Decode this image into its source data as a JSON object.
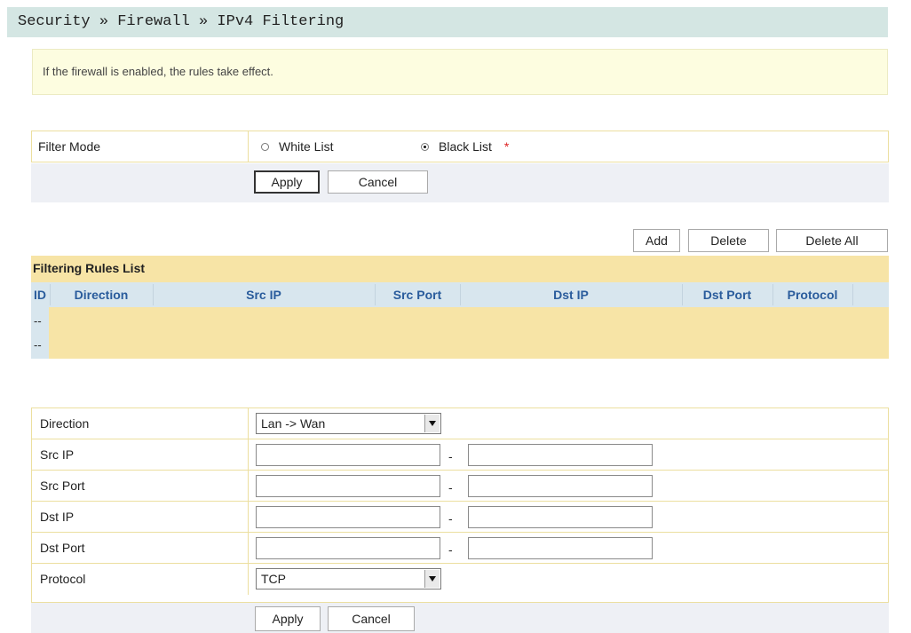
{
  "breadcrumb": "Security » Firewall » IPv4 Filtering",
  "notice": "If the firewall is enabled, the rules take effect.",
  "filter_mode": {
    "label": "Filter Mode",
    "option_white": "White List",
    "option_black": "Black List",
    "selected": "Black List",
    "required_mark": "*",
    "apply": "Apply",
    "cancel": "Cancel"
  },
  "toolbar": {
    "add": "Add",
    "delete": "Delete",
    "delete_all": "Delete All"
  },
  "rules": {
    "title": "Filtering Rules List",
    "columns": [
      "ID",
      "Direction",
      "Src IP",
      "Src Port",
      "Dst IP",
      "Dst Port",
      "Protocol"
    ],
    "rows": [
      [
        "--"
      ],
      [
        "--"
      ]
    ]
  },
  "form": {
    "direction": {
      "label": "Direction",
      "value": "Lan -> Wan"
    },
    "src_ip": {
      "label": "Src IP",
      "from": "",
      "to": ""
    },
    "src_port": {
      "label": "Src Port",
      "from": "",
      "to": ""
    },
    "dst_ip": {
      "label": "Dst IP",
      "from": "",
      "to": ""
    },
    "dst_port": {
      "label": "Dst Port",
      "from": "",
      "to": ""
    },
    "range_sep": "-",
    "protocol": {
      "label": "Protocol",
      "value": "TCP"
    },
    "apply": "Apply",
    "cancel": "Cancel"
  }
}
